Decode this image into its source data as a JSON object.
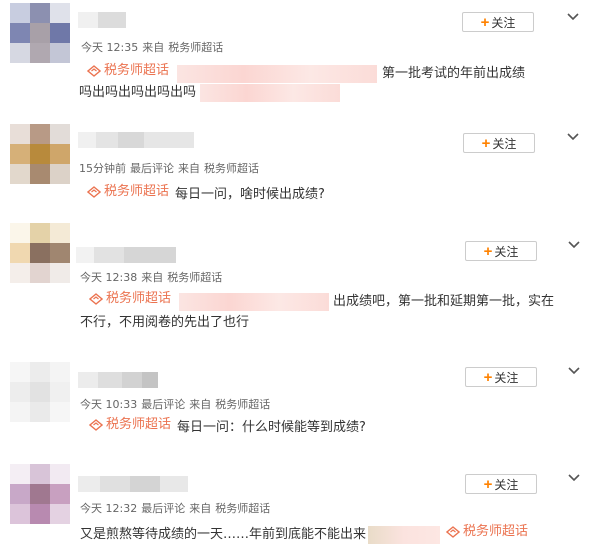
{
  "follow_label": "关注",
  "topic": "税务师超话",
  "posts": [
    {
      "meta": {
        "time": "今天 12:35",
        "source_prefix": "来自",
        "source": "税务师超话"
      },
      "text_line1": "第一批考试的年前出成绩",
      "text_line2": "吗出吗出吗出吗出吗"
    },
    {
      "meta": {
        "time": "15分钟前",
        "status": "最后评论",
        "source_prefix": "来自",
        "source": "税务师超话"
      },
      "text_line1": "每日一问，啥时候出成绩?"
    },
    {
      "meta": {
        "time": "今天 12:38",
        "source_prefix": "来自",
        "source": "税务师超话"
      },
      "text_line1": "出成绩吧，第一批和延期第一批，实在",
      "text_line2": "不行，不用阅卷的先出了也行"
    },
    {
      "meta": {
        "time": "今天 10:33",
        "status": "最后评论",
        "source_prefix": "来自",
        "source": "税务师超话"
      },
      "text_line1": "每日一问：什么时候能等到成绩?"
    },
    {
      "meta": {
        "time": "今天 12:32",
        "status": "最后评论",
        "source_prefix": "来自",
        "source": "税务师超话"
      },
      "text_line1": "又是煎熬等待成绩的一天……年前到底能不能出来"
    }
  ],
  "colors": {
    "topic": "#eb7350",
    "follow_plus": "#ff8200"
  }
}
